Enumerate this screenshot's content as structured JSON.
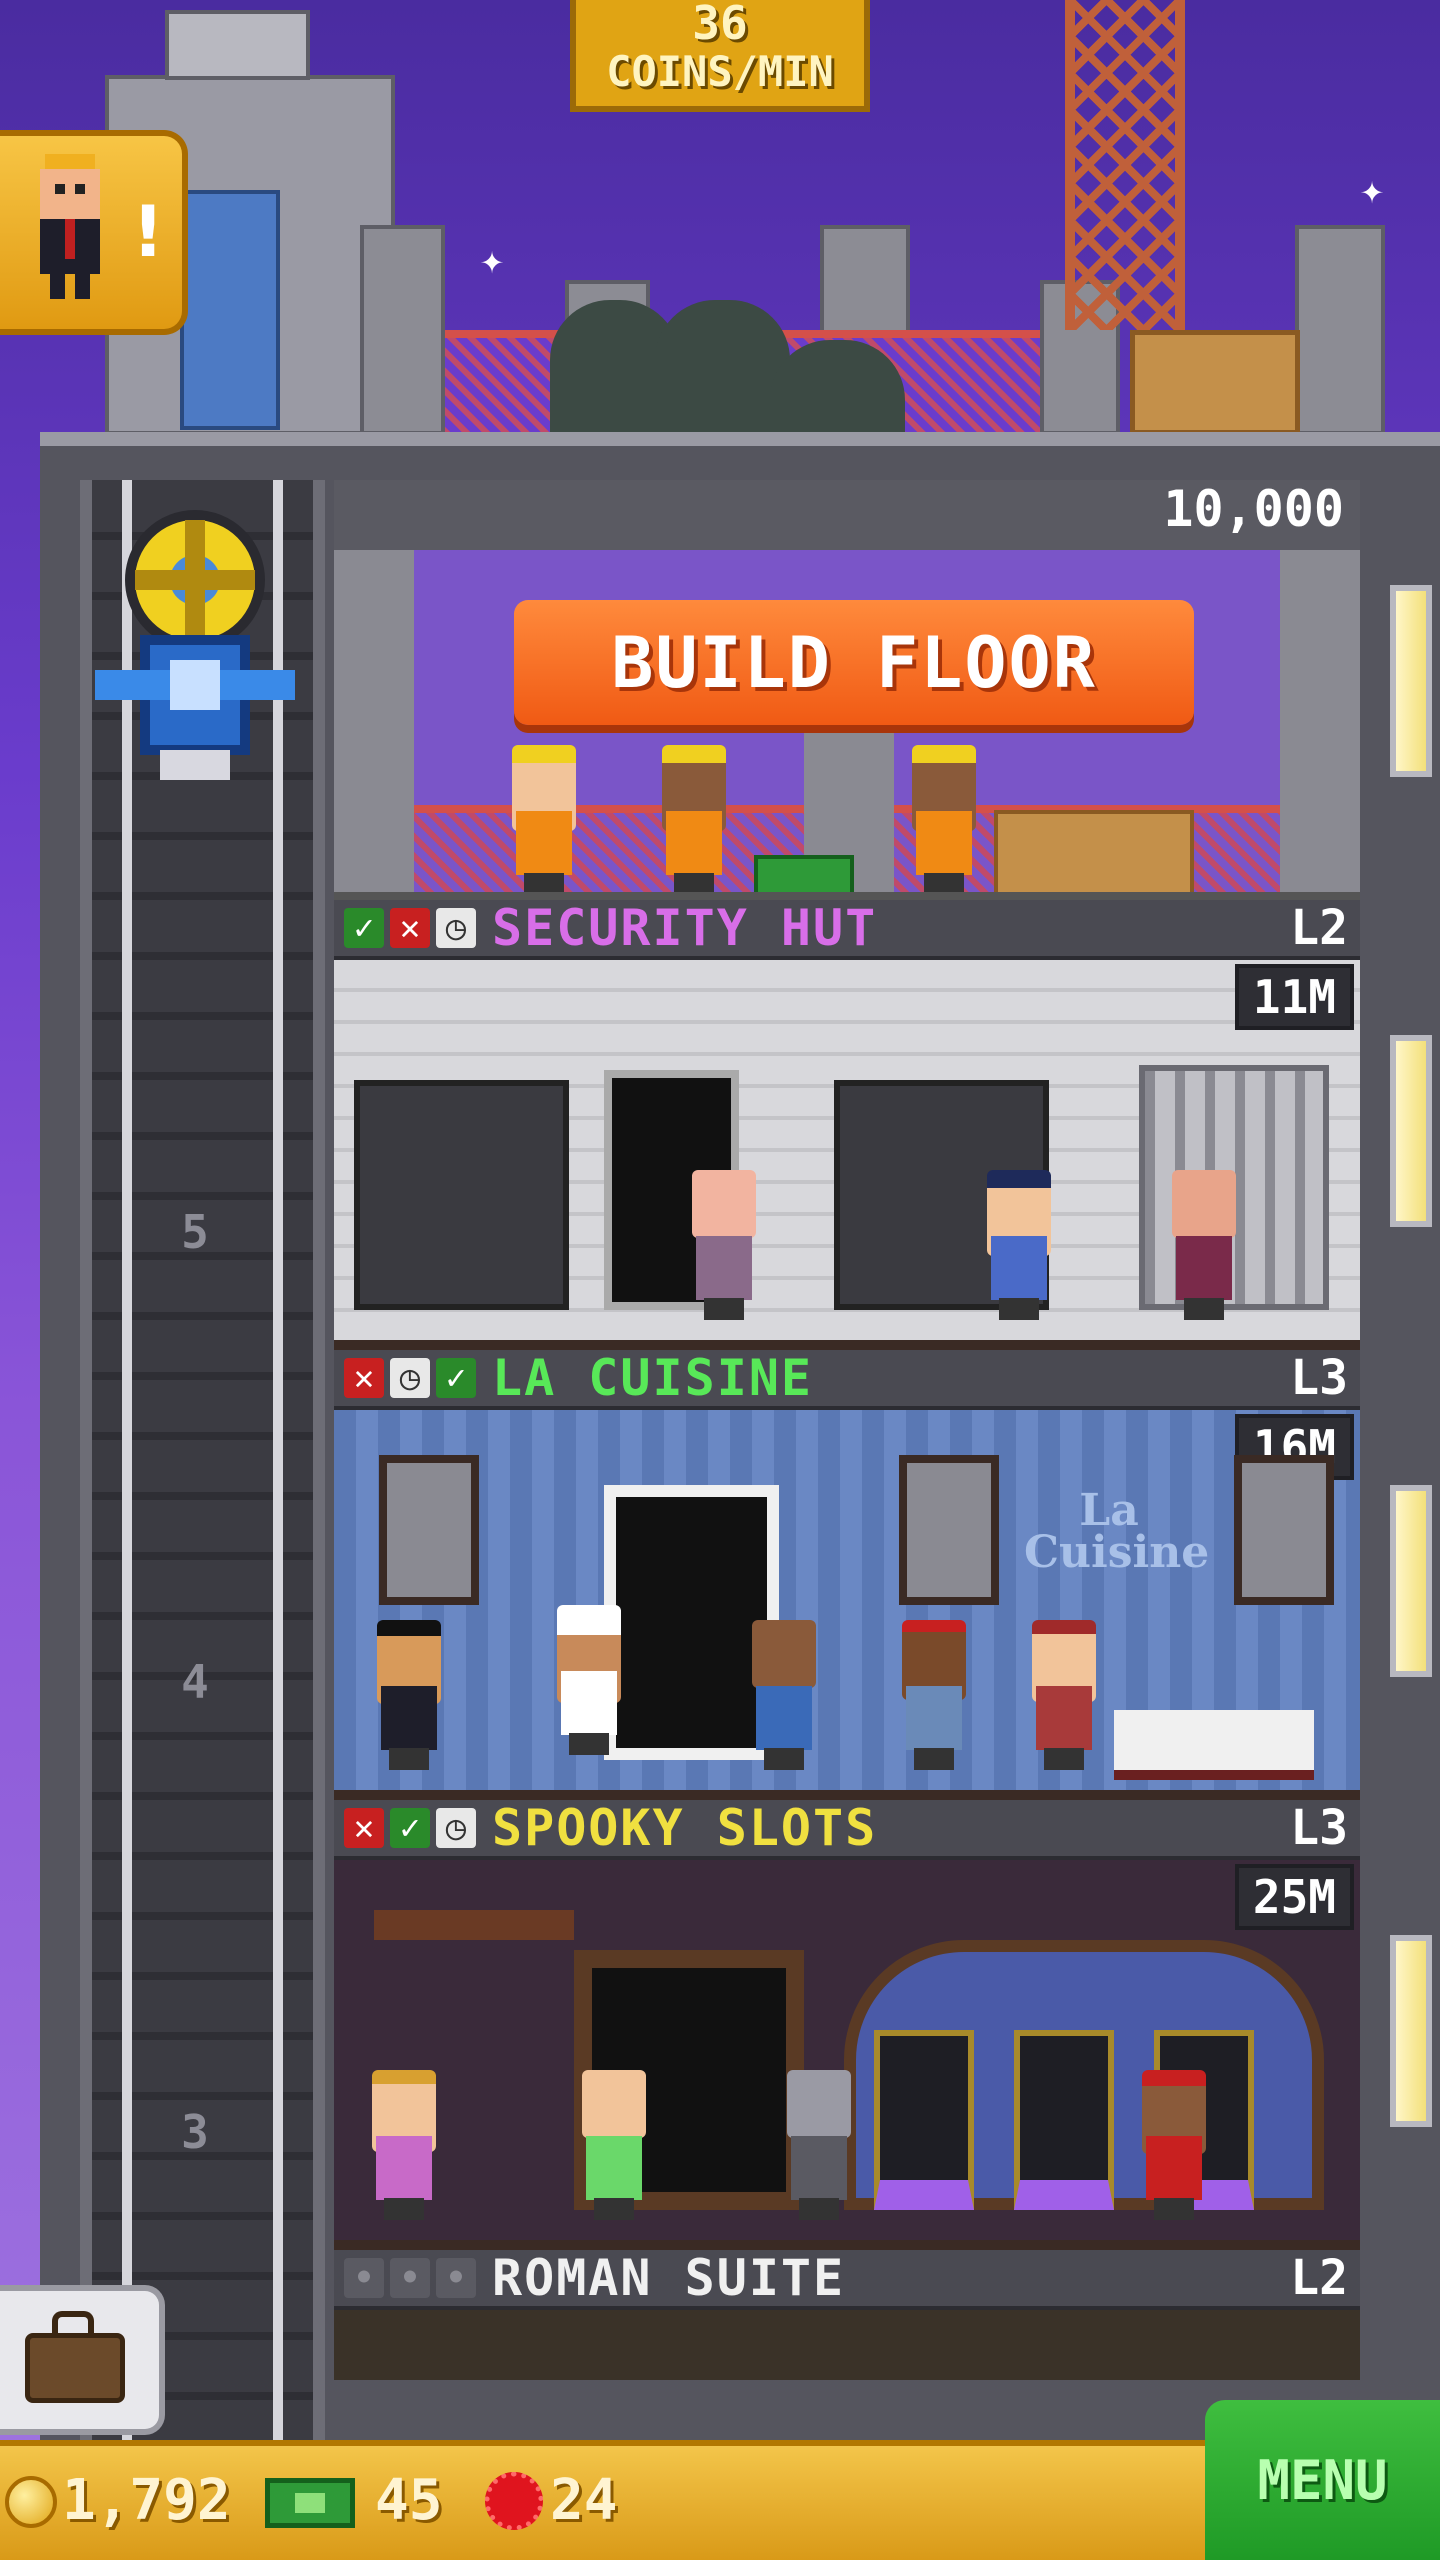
{
  "hud": {
    "coin_rate_value": "36",
    "coin_rate_label": "COINS/MIN"
  },
  "build": {
    "price": "10,000",
    "button_label": "BUILD FLOOR"
  },
  "shaft_numbers": [
    "5",
    "4",
    "3"
  ],
  "floors": [
    {
      "name": "SECURITY HUT",
      "level": "L2",
      "price": "11M",
      "name_color": "#d86ee8",
      "statuses": [
        "check-icon",
        "cross-icon",
        "clock-icon"
      ]
    },
    {
      "name": "LA CUISINE",
      "level": "L3",
      "price": "16M",
      "name_color": "#58e858",
      "sign": "La Cuisine",
      "statuses": [
        "cross-icon",
        "clock-icon",
        "check-icon"
      ]
    },
    {
      "name": "SPOOKY SLOTS",
      "level": "L3",
      "price": "25M",
      "name_color": "#f0e040",
      "statuses": [
        "cross-icon",
        "check-icon",
        "clock-icon"
      ]
    },
    {
      "name": "ROMAN SUITE",
      "level": "L2",
      "name_color": "#f0f0f0",
      "statuses": [
        "empty-slot-icon",
        "empty-slot-icon",
        "empty-slot-icon"
      ]
    }
  ],
  "bottom_bar": {
    "coins": "1,792",
    "bux": "45",
    "gems": "24",
    "menu_label": "MENU"
  },
  "colors": {
    "sky": "#6a3ccc",
    "build_button": "#f05a14",
    "menu_button": "#2aa830",
    "bottom_bar": "#e8b030"
  }
}
